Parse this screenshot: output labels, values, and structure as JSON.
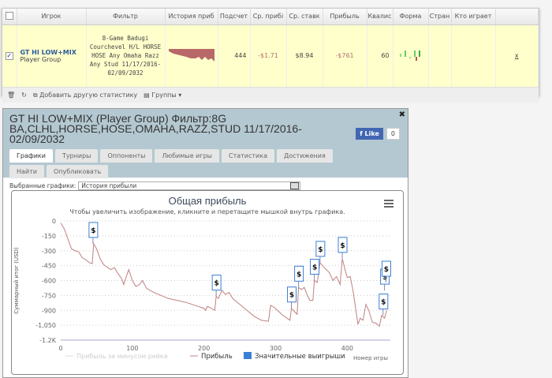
{
  "grid": {
    "columns": [
      "",
      "Игрок",
      "Фильтр",
      "История приб",
      "Подсчет",
      "Ср. прибі",
      "Ср. ставк",
      "Прибыль",
      "Квалис",
      "Форма",
      "Стран",
      "Кто играет",
      ""
    ],
    "row": {
      "checked": true,
      "player": "GT HI LOW+MIX",
      "player_sub": "Player Group",
      "filter": "8-Game Badugi Courchevel H/L HORSE HOSE Any Omaha Razz Any Stud 11/17/2016-02/09/2032",
      "count": "444",
      "avg_profit": "-$1.71",
      "avg_stake": "$8.94",
      "profit": "-$761",
      "qual": "60",
      "remove": "x"
    },
    "footer": {
      "add_stat": "Добавить другую статистику",
      "groups": "Группы"
    }
  },
  "panel": {
    "title": "GT HI LOW+MIX (Player Group) Фильтр:8G BA,CLHL,HORSE,HOSE,OMAHA,RAZZ,STUD 11/17/2016-02/09/2032",
    "like": "Like",
    "like_count": "0",
    "tabs": [
      "Графики",
      "Турниры",
      "Оппоненты",
      "Любимые игры",
      "Статистика",
      "Достижения",
      "Найти",
      "Опубликовать"
    ],
    "select_label": "Выбранные графики:",
    "select_value": "История прибыли"
  },
  "chart_data": {
    "type": "line",
    "title": "Общая прибыль",
    "subtitle": "Чтобы увеличить изображение, кликните и перетащите мышкой внутрь графика.",
    "ylabel": "Суммарный итог (USD)",
    "xlabel": "Номер игры",
    "xlim": [
      0,
      450
    ],
    "ylim": [
      -1200,
      0
    ],
    "xticks": [
      "0",
      "100",
      "200",
      "300",
      "400"
    ],
    "yticks": [
      "0",
      "-150",
      "-300",
      "-450",
      "-600",
      "-750",
      "-900",
      "-1,050",
      "-1.2K"
    ],
    "grid": "horizontal-dotted",
    "legend": [
      "Прибыль за минусом рейка",
      "Прибыль",
      "Значительные выигрыши"
    ],
    "legend_placement": "bottom",
    "line_color": "#c08080",
    "flag_color": "#3a7fd5",
    "series": [
      {
        "name": "Прибыль",
        "points": [
          [
            0,
            -20
          ],
          [
            5,
            -80
          ],
          [
            10,
            -180
          ],
          [
            15,
            -280
          ],
          [
            20,
            -300
          ],
          [
            25,
            -310
          ],
          [
            30,
            -370
          ],
          [
            35,
            -390
          ],
          [
            40,
            -420
          ],
          [
            44,
            -430
          ],
          [
            46,
            -230
          ],
          [
            50,
            -280
          ],
          [
            55,
            -380
          ],
          [
            60,
            -440
          ],
          [
            70,
            -490
          ],
          [
            75,
            -470
          ],
          [
            80,
            -530
          ],
          [
            85,
            -580
          ],
          [
            88,
            -640
          ],
          [
            92,
            -550
          ],
          [
            95,
            -490
          ],
          [
            100,
            -600
          ],
          [
            105,
            -660
          ],
          [
            110,
            -640
          ],
          [
            114,
            -600
          ],
          [
            120,
            -680
          ],
          [
            125,
            -700
          ],
          [
            130,
            -720
          ],
          [
            150,
            -780
          ],
          [
            175,
            -820
          ],
          [
            200,
            -880
          ],
          [
            202,
            -900
          ],
          [
            205,
            -860
          ],
          [
            215,
            -900
          ],
          [
            217,
            -760
          ],
          [
            220,
            -780
          ],
          [
            225,
            -700
          ],
          [
            230,
            -740
          ],
          [
            235,
            -720
          ],
          [
            240,
            -780
          ],
          [
            250,
            -840
          ],
          [
            260,
            -900
          ],
          [
            270,
            -960
          ],
          [
            280,
            -1000
          ],
          [
            290,
            -1010
          ],
          [
            293,
            -850
          ],
          [
            298,
            -870
          ],
          [
            310,
            -950
          ],
          [
            320,
            -1000
          ],
          [
            322,
            -880
          ],
          [
            326,
            -910
          ],
          [
            330,
            -940
          ],
          [
            332,
            -670
          ],
          [
            336,
            -690
          ],
          [
            340,
            -670
          ],
          [
            345,
            -760
          ],
          [
            348,
            -800
          ],
          [
            352,
            -800
          ],
          [
            354,
            -600
          ],
          [
            358,
            -620
          ],
          [
            362,
            -420
          ],
          [
            368,
            -470
          ],
          [
            375,
            -520
          ],
          [
            380,
            -600
          ],
          [
            385,
            -560
          ],
          [
            390,
            -640
          ],
          [
            393,
            -380
          ],
          [
            398,
            -520
          ],
          [
            400,
            -570
          ],
          [
            404,
            -560
          ],
          [
            408,
            -700
          ],
          [
            412,
            -900
          ],
          [
            415,
            -1040
          ],
          [
            418,
            -980
          ],
          [
            422,
            -1000
          ],
          [
            426,
            -840
          ],
          [
            430,
            -900
          ],
          [
            435,
            -1020
          ],
          [
            440,
            -1030
          ],
          [
            445,
            -1060
          ],
          [
            448,
            -950
          ],
          [
            452,
            -980
          ],
          [
            455,
            -900
          ]
        ]
      }
    ],
    "flags": [
      [
        45,
        -230
      ],
      [
        217,
        -760
      ],
      [
        322,
        -880
      ],
      [
        332,
        -670
      ],
      [
        354,
        -600
      ],
      [
        362,
        -420
      ],
      [
        393,
        -380
      ],
      [
        450,
        -950
      ],
      [
        452,
        -700
      ],
      [
        454,
        -620
      ]
    ],
    "flag_text": "$"
  }
}
